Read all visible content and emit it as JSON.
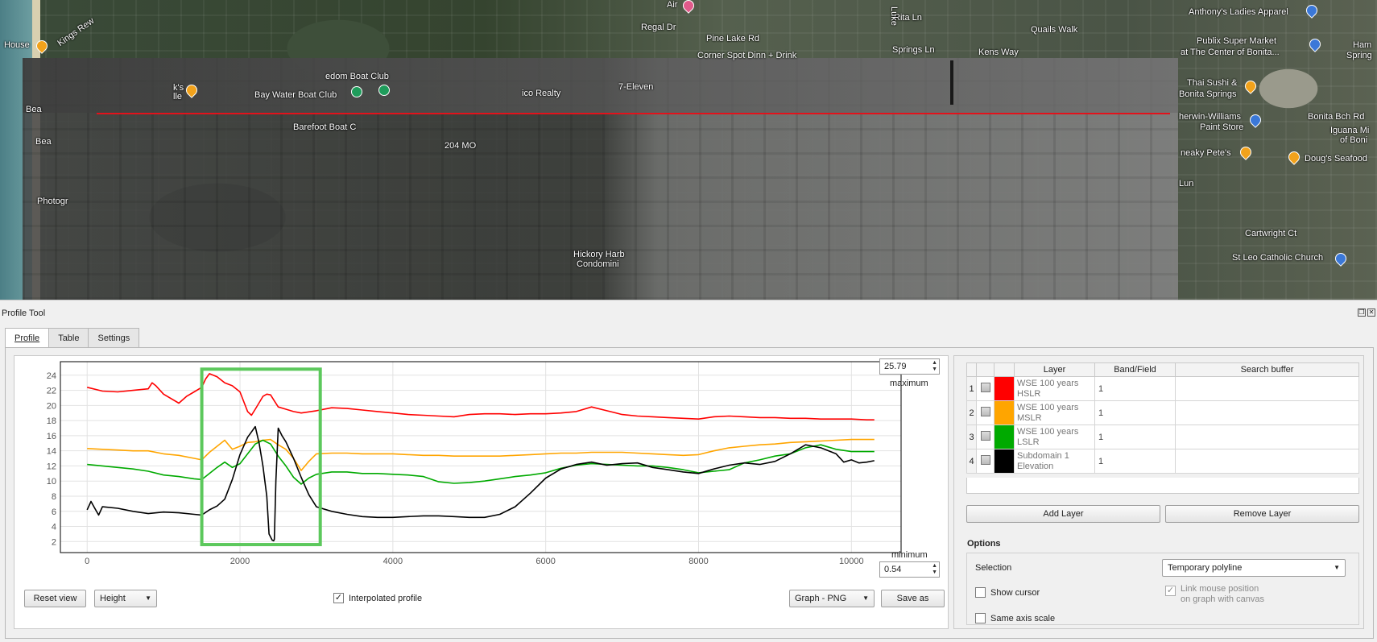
{
  "map": {
    "labels": [
      {
        "text": "House",
        "cls": ""
      },
      {
        "text": "Kings Rew",
        "cls": ""
      },
      {
        "text": "Bay Water Boat Club",
        "cls": ""
      },
      {
        "text": "edom Boat Club",
        "cls": ""
      },
      {
        "text": "Barefoot Boat C",
        "cls": ""
      },
      {
        "text": "204 MO",
        "cls": ""
      },
      {
        "text": "7-Eleven",
        "cls": ""
      },
      {
        "text": "Photogr",
        "cls": ""
      },
      {
        "text": "Regal Dr",
        "cls": ""
      },
      {
        "text": "Pine Lake Rd",
        "cls": ""
      },
      {
        "text": "Corner Spot Dinn + Drink",
        "cls": ""
      },
      {
        "text": "Rita Ln",
        "cls": ""
      },
      {
        "text": "Springs Ln",
        "cls": ""
      },
      {
        "text": "Kens Way",
        "cls": ""
      },
      {
        "text": "Quails Walk",
        "cls": ""
      },
      {
        "text": "Anthony's Ladies Apparel",
        "cls": ""
      },
      {
        "text": "Publix Super Market",
        "cls": ""
      },
      {
        "text": "at The Center of Bonita...",
        "cls": ""
      },
      {
        "text": "Thai Sushi &",
        "cls": ""
      },
      {
        "text": "Bonita Springs",
        "cls": ""
      },
      {
        "text": "Bonita Bch Rd",
        "cls": ""
      },
      {
        "text": "herwin-Williams",
        "cls": ""
      },
      {
        "text": "Paint Store",
        "cls": ""
      },
      {
        "text": "Iguana Mi",
        "cls": ""
      },
      {
        "text": "of Boni",
        "cls": ""
      },
      {
        "text": "neaky Pete's",
        "cls": ""
      },
      {
        "text": "Doug's Seafood",
        "cls": ""
      },
      {
        "text": "Cartwright Ct",
        "cls": ""
      },
      {
        "text": "St Leo Catholic Church",
        "cls": ""
      },
      {
        "text": "Hickory Harb",
        "cls": ""
      },
      {
        "text": "Condomini",
        "cls": ""
      },
      {
        "text": "Air",
        "cls": ""
      },
      {
        "text": "Bea",
        "cls": ""
      },
      {
        "text": "Bea",
        "cls": ""
      },
      {
        "text": "Lun",
        "cls": ""
      },
      {
        "text": "Ham",
        "cls": ""
      },
      {
        "text": "Spring",
        "cls": ""
      },
      {
        "text": "Luke",
        "cls": ""
      },
      {
        "text": "ico Realty",
        "cls": ""
      },
      {
        "text": "k's",
        "cls": ""
      },
      {
        "text": "lle",
        "cls": ""
      }
    ]
  },
  "dock": {
    "title": "Profile Tool",
    "tabs": [
      "Profile",
      "Table",
      "Settings"
    ],
    "plot": {
      "max_value": "25.79",
      "max_label": "maximum",
      "min_value": "0.54",
      "min_label": "minimum",
      "reset_label": "Reset view",
      "mode_value": "Height",
      "interpolated_label": "Interpolated profile",
      "interpolated_checked": true,
      "export_value": "Graph - PNG",
      "save_label": "Save as"
    },
    "layers": {
      "headers": [
        "Layer",
        "Band/Field",
        "Search buffer"
      ],
      "rows": [
        {
          "num": "1",
          "color": "#ff0000",
          "name": "WSE 100 years HSLR",
          "band": "1"
        },
        {
          "num": "2",
          "color": "#ffa500",
          "name": "WSE 100 years MSLR",
          "band": "1"
        },
        {
          "num": "3",
          "color": "#00aa00",
          "name": "WSE 100 years LSLR",
          "band": "1"
        },
        {
          "num": "4",
          "color": "#000000",
          "name": "Subdomain 1 Elevation",
          "band": "1"
        }
      ],
      "add_label": "Add Layer",
      "remove_label": "Remove Layer"
    },
    "options": {
      "title": "Options",
      "selection_label": "Selection",
      "selection_value": "Temporary polyline",
      "show_cursor_label": "Show cursor",
      "same_axis_label": "Same axis scale",
      "link_mouse_label_1": "Link mouse position",
      "link_mouse_label_2": "on graph with canvas"
    }
  },
  "chart_data": {
    "type": "line",
    "title": "",
    "xlabel": "",
    "ylabel": "",
    "xlim": [
      -350,
      10650
    ],
    "ylim": [
      0.54,
      25.79
    ],
    "xticks": [
      0,
      2000,
      4000,
      6000,
      8000,
      10000
    ],
    "yticks": [
      2,
      4,
      6,
      8,
      10,
      12,
      14,
      16,
      18,
      20,
      22,
      24
    ],
    "grid": true,
    "highlight": {
      "x": [
        1500,
        3050
      ],
      "y": [
        1.6,
        24.8
      ],
      "color": "#5cc85c"
    },
    "series": [
      {
        "color": "#ff0000",
        "x": [
          0,
          200,
          400,
          600,
          800,
          850,
          900,
          1000,
          1200,
          1300,
          1400,
          1500,
          1550,
          1600,
          1700,
          1800,
          1900,
          2000,
          2100,
          2150,
          2200,
          2300,
          2350,
          2400,
          2450,
          2500,
          2600,
          2700,
          2800,
          3000,
          3200,
          3400,
          3600,
          3800,
          4000,
          4200,
          4400,
          4600,
          4800,
          5000,
          5200,
          5400,
          5600,
          5800,
          6000,
          6200,
          6400,
          6600,
          6800,
          7000,
          7200,
          7400,
          7600,
          7800,
          8000,
          8200,
          8400,
          8600,
          8800,
          9000,
          9200,
          9400,
          9600,
          9800,
          10000,
          10200,
          10300
        ],
        "values": [
          22.4,
          21.9,
          21.8,
          22.0,
          22.2,
          23.0,
          22.6,
          21.5,
          20.3,
          21.2,
          21.8,
          22.4,
          23.5,
          24.2,
          23.8,
          23.0,
          22.6,
          21.8,
          19.2,
          18.7,
          19.5,
          21.2,
          21.5,
          21.4,
          20.6,
          19.8,
          19.5,
          19.2,
          19.0,
          19.3,
          19.7,
          19.6,
          19.4,
          19.2,
          19.0,
          18.8,
          18.7,
          18.6,
          18.5,
          18.8,
          18.9,
          18.9,
          18.8,
          18.9,
          18.9,
          19.0,
          19.2,
          19.8,
          19.3,
          18.8,
          18.6,
          18.5,
          18.4,
          18.3,
          18.2,
          18.5,
          18.6,
          18.5,
          18.4,
          18.4,
          18.3,
          18.3,
          18.2,
          18.2,
          18.2,
          18.1,
          18.1
        ]
      },
      {
        "color": "#ffa500",
        "x": [
          0,
          200,
          400,
          600,
          800,
          1000,
          1200,
          1400,
          1500,
          1600,
          1700,
          1800,
          1900,
          2000,
          2100,
          2200,
          2300,
          2400,
          2500,
          2600,
          2700,
          2800,
          2900,
          3000,
          3200,
          3400,
          3600,
          3800,
          4000,
          4200,
          4400,
          4600,
          4800,
          5000,
          5200,
          5400,
          5600,
          5800,
          6000,
          6200,
          6400,
          6600,
          6800,
          7000,
          7200,
          7400,
          7600,
          7800,
          8000,
          8200,
          8400,
          8600,
          8800,
          9000,
          9200,
          9400,
          9600,
          9800,
          10000,
          10200,
          10300
        ],
        "values": [
          14.3,
          14.2,
          14.1,
          14.0,
          14.0,
          13.6,
          13.4,
          13.0,
          12.8,
          13.8,
          14.6,
          15.4,
          14.2,
          14.6,
          15.1,
          15.2,
          15.4,
          15.5,
          14.8,
          14.2,
          13.0,
          11.4,
          12.6,
          13.6,
          13.7,
          13.7,
          13.6,
          13.6,
          13.6,
          13.5,
          13.4,
          13.4,
          13.3,
          13.3,
          13.3,
          13.3,
          13.4,
          13.5,
          13.6,
          13.7,
          13.7,
          13.8,
          13.8,
          13.8,
          13.7,
          13.6,
          13.5,
          13.4,
          13.5,
          14.0,
          14.4,
          14.6,
          14.8,
          14.9,
          15.1,
          15.2,
          15.3,
          15.4,
          15.5,
          15.5,
          15.5
        ]
      },
      {
        "color": "#00aa00",
        "x": [
          0,
          200,
          400,
          600,
          800,
          1000,
          1200,
          1400,
          1500,
          1600,
          1700,
          1800,
          1900,
          2000,
          2100,
          2200,
          2300,
          2400,
          2500,
          2600,
          2700,
          2800,
          2900,
          3000,
          3200,
          3400,
          3600,
          3800,
          4000,
          4200,
          4400,
          4600,
          4800,
          5000,
          5200,
          5400,
          5600,
          5800,
          6000,
          6200,
          6400,
          6600,
          6800,
          7000,
          7200,
          7400,
          7600,
          7800,
          8000,
          8200,
          8400,
          8600,
          8800,
          9000,
          9200,
          9400,
          9600,
          9800,
          10000,
          10200,
          10300
        ],
        "values": [
          12.2,
          12.0,
          11.8,
          11.6,
          11.3,
          10.8,
          10.6,
          10.3,
          10.2,
          11.0,
          11.8,
          12.5,
          11.8,
          12.3,
          13.6,
          14.9,
          15.4,
          14.9,
          13.3,
          12.0,
          10.5,
          9.6,
          10.4,
          10.9,
          11.2,
          11.2,
          11.0,
          11.0,
          10.9,
          10.8,
          10.6,
          9.9,
          9.7,
          9.8,
          10.0,
          10.3,
          10.6,
          10.8,
          11.1,
          11.7,
          12.1,
          12.3,
          12.2,
          12.1,
          12.0,
          12.0,
          11.8,
          11.5,
          11.1,
          11.3,
          11.5,
          12.4,
          12.8,
          13.3,
          13.6,
          14.4,
          14.8,
          14.2,
          13.9,
          13.9,
          13.9
        ]
      },
      {
        "color": "#000000",
        "x": [
          0,
          50,
          100,
          150,
          200,
          400,
          600,
          800,
          1000,
          1200,
          1400,
          1500,
          1600,
          1700,
          1800,
          1900,
          2000,
          2100,
          2150,
          2200,
          2250,
          2300,
          2350,
          2380,
          2420,
          2440,
          2450,
          2470,
          2500,
          2550,
          2600,
          2700,
          2800,
          2900,
          3000,
          3200,
          3400,
          3600,
          3800,
          4000,
          4200,
          4400,
          4600,
          4800,
          5000,
          5200,
          5400,
          5600,
          5800,
          6000,
          6200,
          6400,
          6600,
          6800,
          7000,
          7200,
          7400,
          7600,
          7800,
          8000,
          8200,
          8400,
          8600,
          8800,
          9000,
          9200,
          9400,
          9600,
          9800,
          9900,
          10000,
          10100,
          10200,
          10300
        ],
        "values": [
          6.2,
          7.3,
          6.4,
          5.5,
          6.6,
          6.4,
          6.0,
          5.7,
          5.9,
          5.8,
          5.6,
          5.5,
          6.2,
          6.7,
          7.6,
          10.2,
          13.5,
          15.8,
          16.5,
          17.2,
          15.0,
          12.0,
          8.0,
          3.0,
          2.2,
          2.1,
          2.3,
          10.0,
          17.0,
          16.0,
          15.2,
          13.0,
          10.5,
          8.2,
          6.6,
          6.0,
          5.6,
          5.3,
          5.2,
          5.2,
          5.3,
          5.4,
          5.4,
          5.3,
          5.2,
          5.2,
          5.6,
          6.6,
          8.4,
          10.4,
          11.6,
          12.2,
          12.5,
          12.1,
          12.3,
          12.4,
          11.8,
          11.5,
          11.2,
          11.0,
          11.6,
          12.1,
          12.4,
          12.2,
          12.6,
          13.6,
          14.8,
          14.4,
          13.6,
          12.5,
          12.8,
          12.4,
          12.5,
          12.7
        ]
      }
    ]
  }
}
